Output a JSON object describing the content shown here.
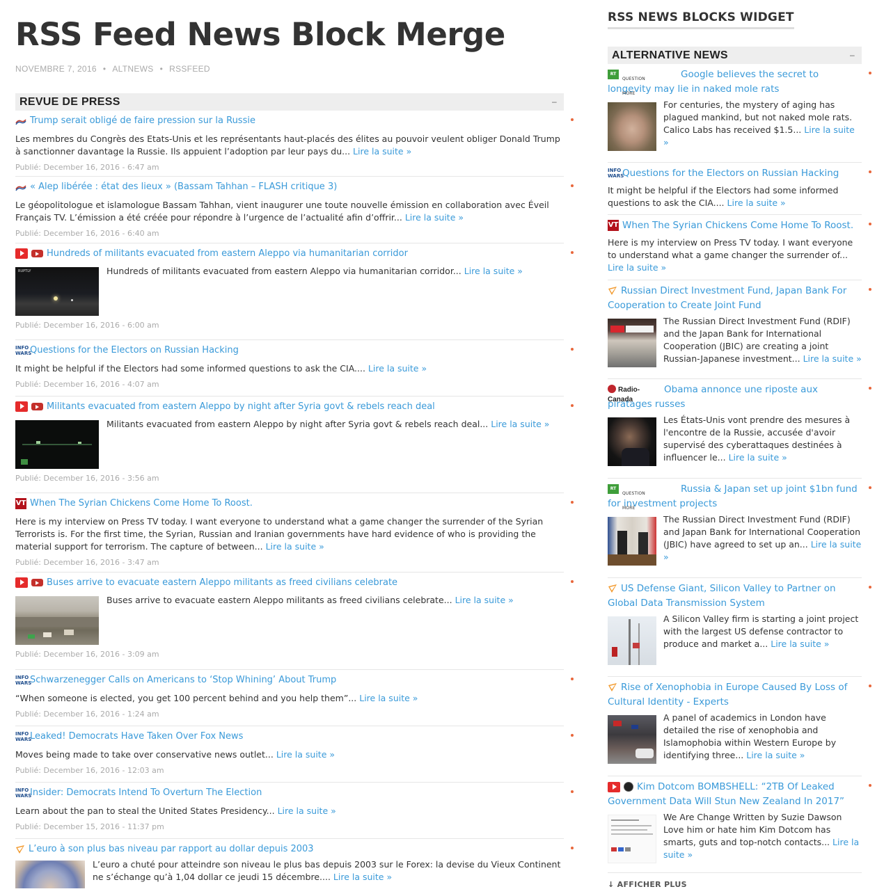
{
  "page": {
    "title": "RSS Feed News Block Merge",
    "meta": {
      "date": "NOVEMBRE 7, 2016",
      "cat1": "ALTNEWS",
      "cat2": "RSSFEED"
    }
  },
  "main_block": {
    "heading": "REVUE DE PRESS",
    "toggle": "–",
    "read_more": "Lire la suite »",
    "items": [
      {
        "icon": "french-flag-icon",
        "title": "Trump serait obligé de faire pression sur la Russie",
        "desc": "Les membres du Congrès des Etats-Unis et les représentants haut-placés des élites au pouvoir veulent obliger Donald Trump à sanctionner davantage la Russie. Ils appuient l’adoption par leur pays du...",
        "date": "Publié: December 16, 2016 - 6:47 am"
      },
      {
        "icon": "french-flag-icon",
        "title": "« Alep libérée : état des lieux » (Bassam Tahhan – FLASH critique 3)",
        "desc": "Le géopolitologue et islamologue Bassam Tahhan, vient inaugurer une toute nouvelle émission en collaboration avec Éveil Français TV. L’émission a été créée pour répondre à l’urgence de l’actualité afin d’offrir...",
        "date": "Publié: December 16, 2016 - 6:40 am"
      },
      {
        "icon": "youtube-icon",
        "title": "Hundreds of militants evacuated from eastern Aleppo via humanitarian corridor",
        "desc": "Hundreds of militants evacuated from eastern Aleppo via humanitarian corridor...",
        "date": "Publié: December 16, 2016 - 6:00 am",
        "thumb_label": "RUPTLY"
      },
      {
        "icon": "infowars-icon",
        "title": "Questions for the Electors on Russian Hacking",
        "desc": "It might be helpful if the Electors had some informed questions to ask the CIA....",
        "date": "Publié: December 16, 2016 - 4:07 am"
      },
      {
        "icon": "youtube-icon",
        "title": "Militants evacuated from eastern Aleppo by night after Syria govt & rebels reach deal",
        "desc": "Militants evacuated from eastern Aleppo by night after Syria govt & rebels reach deal...",
        "date": "Publié: December 16, 2016 - 3:56 am"
      },
      {
        "icon": "vt-icon",
        "title": "When The Syrian Chickens Come Home To Roost.",
        "desc": "Here is my interview on Press TV today. I want everyone to understand what a game changer the surrender of the Syrian Terrorists is. For the first time, the Syrian, Russian and Iranian governments have hard evidence of who is providing the material support for terrorism. The capture of between...",
        "date": "Publié: December 16, 2016 - 3:47 am"
      },
      {
        "icon": "youtube-icon",
        "title": "Buses arrive to evacuate eastern Aleppo militants as freed civilians celebrate",
        "desc": "Buses arrive to evacuate eastern Aleppo militants as freed civilians celebrate...",
        "date": "Publié: December 16, 2016 - 3:09 am"
      },
      {
        "icon": "infowars-icon",
        "title": "Schwarzenegger Calls on Americans to ‘Stop Whining’ About Trump",
        "desc": "“When someone is elected, you get 100 percent behind and you help them”...",
        "date": "Publié: December 16, 2016 - 1:24 am"
      },
      {
        "icon": "infowars-icon",
        "title": "Leaked! Democrats Have Taken Over Fox News",
        "desc": "Moves being made to take over conservative news outlet...",
        "date": "Publié: December 16, 2016 - 12:03 am"
      },
      {
        "icon": "infowars-icon",
        "title": "Insider: Democrats Intend To Overturn The Election",
        "desc": "Learn about the pan to steal the United States Presidency...",
        "date": "Publié: December 15, 2016 - 11:37 pm"
      },
      {
        "icon": "ria-icon",
        "title": "L’euro à son plus bas niveau par rapport au dollar depuis 2003",
        "desc": "L’euro a chuté pour atteindre son niveau le plus bas depuis 2003 sur le Forex: la devise du Vieux Continent ne s’échange qu’à 1,04 dollar ce jeudi 15 décembre...."
      }
    ]
  },
  "sidebar": {
    "widget_title": "RSS NEWS BLOCKS WIDGET",
    "heading": "ALTERNATIVE NEWS",
    "toggle": "–",
    "read_more": "Lire la suite »",
    "rt_label": "QUESTION MORE",
    "rt_logo": "RT",
    "rc_label": "Radio-Canada",
    "iw_label": "INFO WARS",
    "vt_label": "VT",
    "items": [
      {
        "icon": "rt-icon",
        "title": "Google believes the secret to longevity may lie in naked mole rats",
        "desc": "For centuries, the mystery of aging has plagued mankind, but not naked mole rats. Calico Labs has received $1.5..."
      },
      {
        "icon": "infowars-icon",
        "title": "Questions for the Electors on Russian Hacking",
        "desc": "It might be helpful if the Electors had some informed questions to ask the CIA...."
      },
      {
        "icon": "vt-icon",
        "title": "When The Syrian Chickens Come Home To Roost.",
        "desc": "Here is my interview on Press TV today. I want everyone to understand what a game changer the surrender of..."
      },
      {
        "icon": "ria-icon",
        "title": "Russian Direct Investment Fund, Japan Bank For Cooperation to Create Joint Fund",
        "desc": "The Russian Direct Investment Fund (RDIF) and the Japan Bank for International Cooperation (JBIC) are creating a joint Russian-Japanese investment..."
      },
      {
        "icon": "radio-canada-icon",
        "title": "Obama annonce une riposte aux piratages russes",
        "desc": "Les États-Unis vont prendre des mesures à l'encontre de la Russie, accusée d'avoir supervisé des cyberattaques destinées à influencer le..."
      },
      {
        "icon": "rt-icon",
        "title": "Russia & Japan set up joint $1bn fund for investment projects",
        "desc": "The Russian Direct Investment Fund (RDIF) and Japan Bank for International Cooperation (JBIC) have agreed to set up an..."
      },
      {
        "icon": "ria-icon",
        "title": "US Defense Giant, Silicon Valley to Partner on Global Data Transmission System",
        "desc": "A Silicon Valley firm is starting a joint project with the largest US defense contractor to produce and market a..."
      },
      {
        "icon": "ria-icon",
        "title": "Rise of Xenophobia in Europe Caused By Loss of Cultural Identity - Experts",
        "desc": "A panel of academics in London have detailed the rise of xenophobia and Islamophobia within Western Europe by identifying three..."
      },
      {
        "icon": "youtube-icon",
        "title": "Kim Dotcom BOMBSHELL: “2TB Of Leaked Government Data Will Stun New Zealand In 2017”",
        "desc": "We Are Change Written by Suzie Dawson Love him or hate him Kim Dotcom has smarts, guts and top-notch contacts..."
      }
    ],
    "more": "↓ AFFICHER PLUS"
  },
  "colors": {
    "link": "#3a9ad9",
    "bullet": "#e8673c",
    "heading_bg": "#eeeeee"
  }
}
